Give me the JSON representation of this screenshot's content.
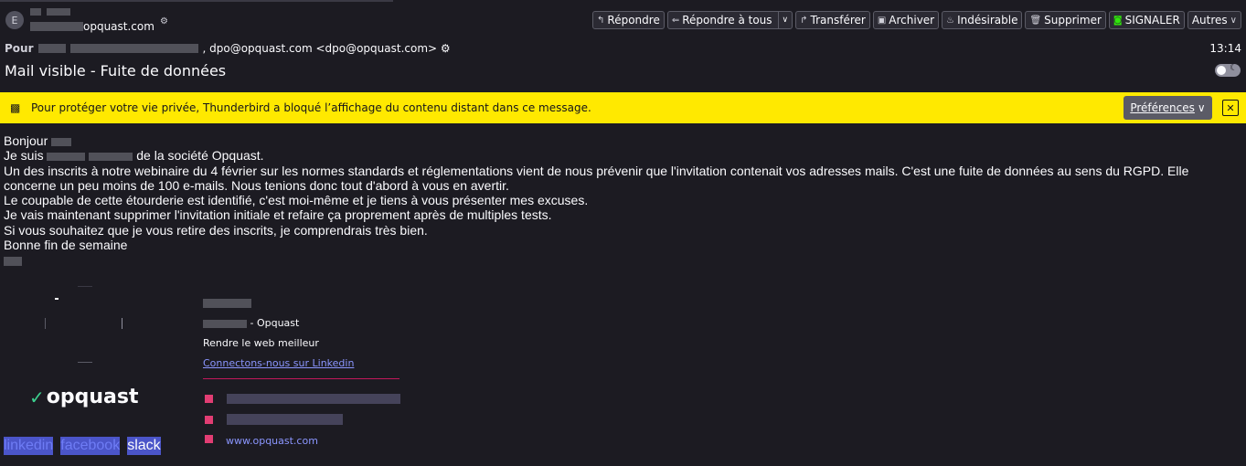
{
  "header": {
    "avatar_letter": "E",
    "from_domain": "opquast.com",
    "from_badge": "⚙",
    "to_label": "Pour",
    "to_visible": ", dpo@opquast.com <dpo@opquast.com> ⚙",
    "time": "13:14",
    "subject": "Mail visible - Fuite de données"
  },
  "toolbar": {
    "reply": "Répondre",
    "reply_all": "Répondre à tous",
    "forward": "Transférer",
    "archive": "Archiver",
    "junk": "Indésirable",
    "delete": "Supprimer",
    "report": "SIGNALER",
    "more": "Autres"
  },
  "notice": {
    "text": "Pour protéger votre vie privée, Thunderbird a bloqué l’affichage du contenu distant dans ce message.",
    "preferences": "Préférences",
    "close": "✕"
  },
  "message": {
    "greeting": "Bonjour",
    "intro_prefix": "Je suis",
    "intro_suffix": "de la société Opquast.",
    "line1": "Un des inscrits à notre webinaire du 4 février sur les normes standards et réglementations vient de nous prévenir que l'invitation contenait vos adresses mails. C'est une fuite de données au sens du RGPD. Elle concerne un peu moins de 100 e-mails. Nous tenions donc tout d'abord à vous en avertir.",
    "line2": "Le coupable de cette étourderie est identifié, c'est moi-même et je tiens à vous présenter mes excuses.",
    "line3": "Je vais maintenant supprimer l'invitation initiale et refaire ça proprement après de multiples tests.",
    "line4": "Si vous souhaitez que je vous retire des inscrits, je comprendrais très bien.",
    "closing": "Bonne fin de semaine"
  },
  "signature": {
    "logo_text": "opquast",
    "role_suffix": "- Opquast",
    "tagline": "Rendre le web meilleur",
    "linkedin_cta": "Connectons-nous sur Linkedin",
    "website": "www.opquast.com",
    "social": [
      "linkedin",
      "facebook",
      "slack"
    ]
  }
}
